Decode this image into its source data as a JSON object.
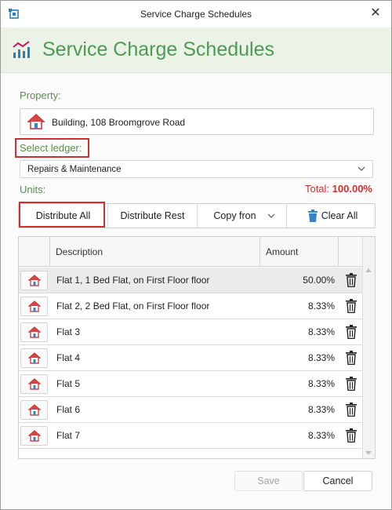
{
  "window": {
    "title": "Service Charge Schedules",
    "close_label": "✕"
  },
  "header": {
    "title": "Service Charge Schedules"
  },
  "property": {
    "label": "Property:",
    "value": "Building, 108 Broomgrove Road"
  },
  "ledger": {
    "label": "Select ledger:",
    "selected": "Repairs & Maintenance"
  },
  "units": {
    "label": "Units:",
    "total_label": "Total:",
    "total_value": "100.00%"
  },
  "toolbar": {
    "distribute_all": "Distribute All",
    "distribute_rest": "Distribute Rest",
    "copy_from": "Copy fron",
    "clear_all": "Clear All"
  },
  "grid": {
    "columns": [
      "Description",
      "Amount"
    ],
    "rows": [
      {
        "description": "Flat 1, 1 Bed Flat, on First Floor floor",
        "amount": "50.00%"
      },
      {
        "description": "Flat 2, 2 Bed Flat, on First Floor floor",
        "amount": "8.33%"
      },
      {
        "description": "Flat 3",
        "amount": "8.33%"
      },
      {
        "description": "Flat 4",
        "amount": "8.33%"
      },
      {
        "description": "Flat 5",
        "amount": "8.33%"
      },
      {
        "description": "Flat 6",
        "amount": "8.33%"
      },
      {
        "description": "Flat 7",
        "amount": "8.33%"
      }
    ]
  },
  "footer": {
    "save_label": "Save",
    "cancel_label": "Cancel"
  },
  "colors": {
    "accent_green": "#4e9a55",
    "header_bg": "#eaf3e6",
    "highlight_red": "#d32f2f"
  }
}
